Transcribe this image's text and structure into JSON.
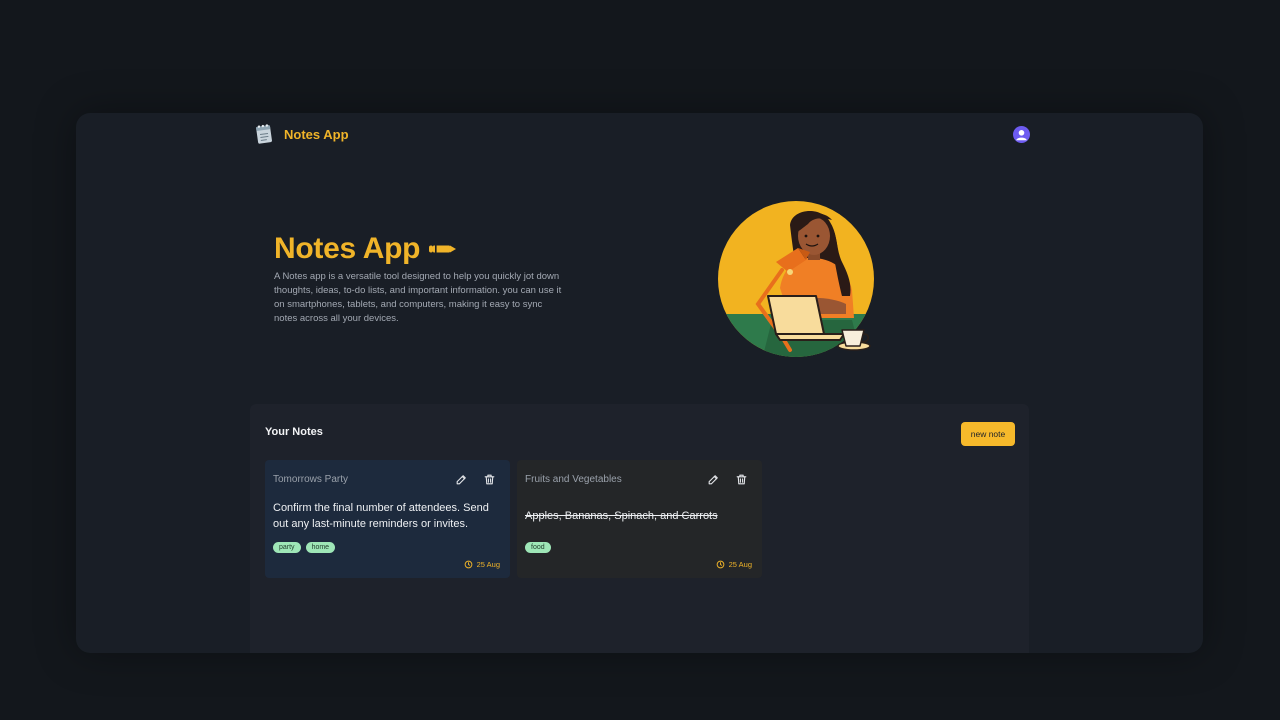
{
  "header": {
    "app_name": "Notes App",
    "logo_icon": "notepad-icon",
    "avatar_icon": "user-avatar-icon"
  },
  "hero": {
    "title": "Notes App",
    "title_icon": "pencil-icon",
    "description": "A Notes app is a versatile tool designed to help you quickly jot down thoughts, ideas, to-do lists, and important information. you can use it on smartphones, tablets, and computers, making it easy to sync notes across all your devices.",
    "illustration": "woman-working-on-laptop-illustration"
  },
  "notes_section": {
    "heading": "Your Notes",
    "new_note_label": "new note",
    "notes": [
      {
        "title": "Tomorrows Party",
        "body": "Confirm the final number of attendees. Send out any last-minute reminders or invites.",
        "tags": [
          "party",
          "home"
        ],
        "date": "25 Aug",
        "completed": false
      },
      {
        "title": "Fruits and Vegetables",
        "body": "Apples, Bananas, Spinach, and Carrots",
        "tags": [
          "food"
        ],
        "date": "25 Aug",
        "completed": true
      }
    ]
  },
  "colors": {
    "accent": "#f0b429",
    "button": "#f6b92b",
    "page_bg": "#13171c",
    "frame_bg": "#191e26",
    "panel_bg": "#1e222b",
    "card_active_bg": "#1d2a3d",
    "card_completed_bg": "#242628",
    "tag_bg": "#9ee6b7",
    "avatar_bg": "#6d5bf0"
  }
}
